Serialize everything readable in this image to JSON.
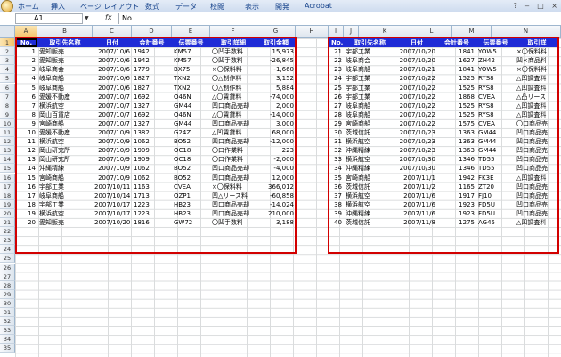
{
  "ribbon": {
    "menu": [
      "ホーム",
      "挿入",
      "ページ レイアウト",
      "数式",
      "データ",
      "校閲",
      "表示",
      "開発",
      "Acrobat"
    ],
    "window_controls": [
      "?",
      "‒",
      "□",
      "×"
    ]
  },
  "formula_bar": {
    "name_box": "A1",
    "fx": "fx",
    "content": "No."
  },
  "columns": [
    "A",
    "B",
    "C",
    "D",
    "E",
    "F",
    "G",
    "H",
    "I",
    "J",
    "K",
    "L",
    "M",
    "N"
  ],
  "rows": [
    "1",
    "2",
    "3",
    "4",
    "5",
    "6",
    "7",
    "8",
    "9",
    "10",
    "11",
    "12",
    "13",
    "14",
    "15",
    "16",
    "17",
    "18",
    "19",
    "20",
    "21",
    "22",
    "23",
    "24",
    "25",
    "26",
    "27",
    "28",
    "29",
    "30",
    "31",
    "32",
    "33",
    "34",
    "35"
  ],
  "left_table": {
    "headers": [
      "No.",
      "取引先名称",
      "日付",
      "会計番号",
      "伝票番号",
      "取引詳細",
      "取引金額"
    ],
    "rows": [
      [
        "1",
        "愛知販売",
        "2007/10/6",
        "1942",
        "KM57",
        "〇凹手数料",
        "15,973"
      ],
      [
        "2",
        "愛知販売",
        "2007/10/6",
        "1942",
        "KM57",
        "〇凹手数料",
        "-26,845"
      ],
      [
        "3",
        "岐阜商会",
        "2007/10/6",
        "1779",
        "BX75",
        "×〇保料料",
        "-1,660"
      ],
      [
        "4",
        "岐阜商船",
        "2007/10/6",
        "1827",
        "TXN2",
        "〇△制作料",
        "3,152"
      ],
      [
        "5",
        "岐阜商船",
        "2007/10/6",
        "1827",
        "TXN2",
        "〇△制作料",
        "5,884"
      ],
      [
        "6",
        "愛媛不動産",
        "2007/10/7",
        "1692",
        "O46N",
        "△〇賃貸料",
        "-74,000"
      ],
      [
        "7",
        "横浜航空",
        "2007/10/7",
        "1327",
        "GM44",
        "凹口商品売却",
        "2,000"
      ],
      [
        "8",
        "岡山百貨店",
        "2007/10/7",
        "1692",
        "O46N",
        "△〇賃貸料",
        "-14,000"
      ],
      [
        "9",
        "宮崎商船",
        "2007/10/7",
        "1327",
        "GM44",
        "凹口商品売却",
        "3,000"
      ],
      [
        "10",
        "愛媛不動産",
        "2007/10/9",
        "1382",
        "G24Z",
        "△凹賃貸料",
        "68,000"
      ],
      [
        "11",
        "横浜航空",
        "2007/10/9",
        "1062",
        "BO52",
        "凹口商品売却",
        "-12,000"
      ],
      [
        "12",
        "岡山研究所",
        "2007/10/9",
        "1909",
        "OC18",
        "〇口作業料",
        "223"
      ],
      [
        "13",
        "岡山研究所",
        "2007/10/9",
        "1909",
        "OC18",
        "〇口作業料",
        "-2,000"
      ],
      [
        "14",
        "沖縄精練",
        "2007/10/9",
        "1062",
        "BO52",
        "凹口商品売却",
        "-4,000"
      ],
      [
        "15",
        "宮崎商船",
        "2007/10/9",
        "1062",
        "BO52",
        "凹口商品売却",
        "12,000"
      ],
      [
        "16",
        "宇部工業",
        "2007/10/11",
        "1163",
        "CVEA",
        "×〇保料料",
        "366,012"
      ],
      [
        "17",
        "岐阜商船",
        "2007/10/14",
        "1713",
        "OZP1",
        "凹△リース料",
        "-60,858"
      ],
      [
        "18",
        "宇部工業",
        "2007/10/17",
        "1223",
        "HB23",
        "凹口商品売却",
        "-14,024"
      ],
      [
        "19",
        "横浜航空",
        "2007/10/17",
        "1223",
        "HB23",
        "凹口商品売却",
        "210,000"
      ],
      [
        "20",
        "愛知販売",
        "2007/10/20",
        "1816",
        "GW72",
        "〇凹手数料",
        "3,188"
      ]
    ]
  },
  "right_table": {
    "headers": [
      "No.",
      "取引先名称",
      "日付",
      "会計番号",
      "伝票番号",
      "取引詳"
    ],
    "rows": [
      [
        "21",
        "宇部工業",
        "2007/10/20",
        "1841",
        "YOW5",
        "×〇保料料"
      ],
      [
        "22",
        "岐阜商会",
        "2007/10/20",
        "1627",
        "ZH42",
        "凹×商品料"
      ],
      [
        "23",
        "岐阜商船",
        "2007/10/21",
        "1841",
        "YOW5",
        "×〇保料料"
      ],
      [
        "24",
        "宇部工業",
        "2007/10/22",
        "1525",
        "RYS8",
        "△凹調査料"
      ],
      [
        "25",
        "宇部工業",
        "2007/10/22",
        "1525",
        "RYS8",
        "△凹調査料"
      ],
      [
        "26",
        "宇部工業",
        "2007/10/22",
        "1868",
        "CVEA",
        "△凸リース"
      ],
      [
        "27",
        "岐阜商船",
        "2007/10/22",
        "1525",
        "RYS8",
        "△凹調査料"
      ],
      [
        "28",
        "岐阜商船",
        "2007/10/22",
        "1525",
        "RYS8",
        "△凹調査料"
      ],
      [
        "29",
        "宮崎商船",
        "2007/10/22",
        "1575",
        "CVEA",
        "〇口商品売"
      ],
      [
        "30",
        "茨城信託",
        "2007/10/23",
        "1363",
        "GM44",
        "凹口商品売"
      ],
      [
        "31",
        "横浜航空",
        "2007/10/23",
        "1363",
        "GM44",
        "凹口商品売"
      ],
      [
        "32",
        "沖縄精練",
        "2007/10/23",
        "1363",
        "GM44",
        "凹口商品売"
      ],
      [
        "33",
        "横浜航空",
        "2007/10/30",
        "1346",
        "TD55",
        "凹口商品売"
      ],
      [
        "34",
        "沖縄精練",
        "2007/10/30",
        "1346",
        "TD55",
        "凹口商品売"
      ],
      [
        "35",
        "宮崎商船",
        "2007/11/1",
        "1942",
        "FK3E",
        "△凹調査料"
      ],
      [
        "36",
        "茨城信託",
        "2007/11/2",
        "1165",
        "ZT20",
        "凹口商品売"
      ],
      [
        "37",
        "横浜航空",
        "2007/11/6",
        "1917",
        "FJ10",
        "凹口商品売"
      ],
      [
        "38",
        "横浜航空",
        "2007/11/6",
        "1923",
        "FD5U",
        "凹口商品売"
      ],
      [
        "39",
        "沖縄精練",
        "2007/11/6",
        "1923",
        "FD5U",
        "凹口商品売"
      ],
      [
        "40",
        "茨城信託",
        "2007/11/8",
        "1275",
        "AG45",
        "△凹調査料"
      ]
    ]
  },
  "colors": {
    "header_fill": "#1f2bd6",
    "highlight_border": "#d20000"
  }
}
